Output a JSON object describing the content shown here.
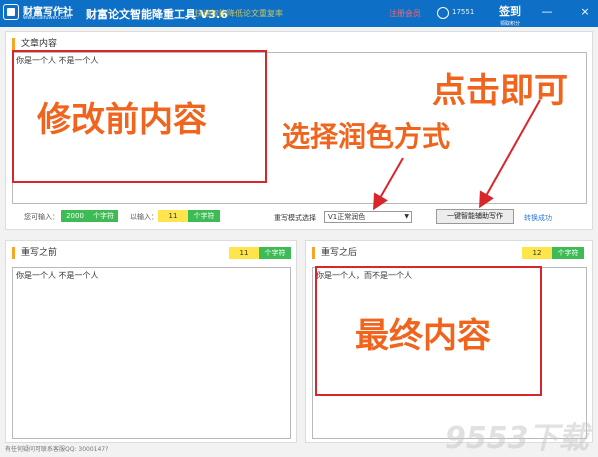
{
  "titlebar": {
    "logo_name": "财富写作社",
    "logo_url": "www.caifuwen.com",
    "app_title": "财富论文智能降重工具 V3.6",
    "slogan": "快速智能降低论文重复率",
    "register": "注册会员",
    "user_id": "17551",
    "signin_label": "签到",
    "signin_sub": "领取积分",
    "minimize_icon": "—",
    "close_icon": "×",
    "accent_color": "#0e6fc6"
  },
  "article": {
    "title": "文章内容",
    "text": "你是一个人 不是一个人",
    "input_label": "您可输入：",
    "input_count": "2000",
    "unit": "个字符",
    "entered_label": "以输入：",
    "entered_count": "11",
    "mode_label": "重写模式选择",
    "mode_value": "V1正常润色",
    "rewrite_button": "一键智能辅助写作",
    "status": "转换成功"
  },
  "before": {
    "title": "重写之前",
    "count": "11",
    "unit": "个字符",
    "text": "你是一个人 不是一个人"
  },
  "after": {
    "title": "重写之后",
    "count": "12",
    "unit": "个字符",
    "text": "你是一个人，而不是一个人"
  },
  "annotations": {
    "before_content": "修改前内容",
    "choose_mode": "选择润色方式",
    "click": "点击即可",
    "final_content": "最终内容",
    "color": "#f0641e",
    "box_color": "#d9262b"
  },
  "footer": "有任何疑问可联系客服QQ: 3000147?",
  "watermark": "9553下载"
}
